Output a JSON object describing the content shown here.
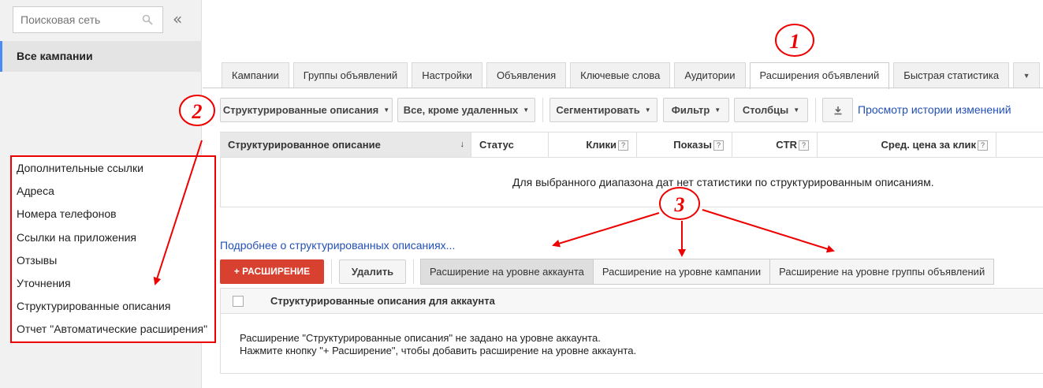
{
  "sidebar": {
    "search_placeholder": "Поисковая сеть",
    "collapse": "«",
    "all_campaigns": "Все кампании",
    "extensions": [
      "Дополнительные ссылки",
      "Адреса",
      "Номера телефонов",
      "Ссылки на приложения",
      "Отзывы",
      "Уточнения",
      "Структурированные описания",
      "Отчет \"Автоматические расширения\""
    ]
  },
  "tabs": [
    {
      "label": "Кампании"
    },
    {
      "label": "Группы объявлений"
    },
    {
      "label": "Настройки"
    },
    {
      "label": "Объявления"
    },
    {
      "label": "Ключевые слова"
    },
    {
      "label": "Аудитории"
    },
    {
      "label": "Расширения объявлений",
      "active": true
    },
    {
      "label": "Быстрая статистика"
    }
  ],
  "toolbar": {
    "ext_type": "Структурированные описания",
    "filter_status": "Все, кроме удаленных",
    "segment": "Сегментировать",
    "filter": "Фильтр",
    "columns": "Столбцы",
    "history_link": "Просмотр истории изменений"
  },
  "stats_table": {
    "columns": [
      "Структурированное описание",
      "Статус",
      "Клики",
      "Показы",
      "CTR",
      "Сред. цена за клик"
    ],
    "empty_message": "Для выбранного диапазона дат нет статистики по структурированным описаниям."
  },
  "more_link": "Подробнее о структурированных описаниях...",
  "actions": {
    "add": "+ РАСШИРЕНИЕ",
    "delete": "Удалить",
    "levels": [
      "Расширение на уровне аккаунта",
      "Расширение на уровне кампании",
      "Расширение на уровне группы объявлений"
    ]
  },
  "account_table": {
    "header": "Структурированные описания для аккаунта",
    "message_line1": "Расширение \"Структурированные описания\" не задано на уровне аккаунта.",
    "message_line2": "Нажмите кнопку \"+ Расширение\", чтобы добавить расширение на уровне аккаунта."
  },
  "annotations": [
    "1",
    "2",
    "3"
  ],
  "colors": {
    "accent_red": "#e00000",
    "link_blue": "#2250b7",
    "sidebar_accent": "#4a8af4",
    "add_button": "#d84030"
  }
}
